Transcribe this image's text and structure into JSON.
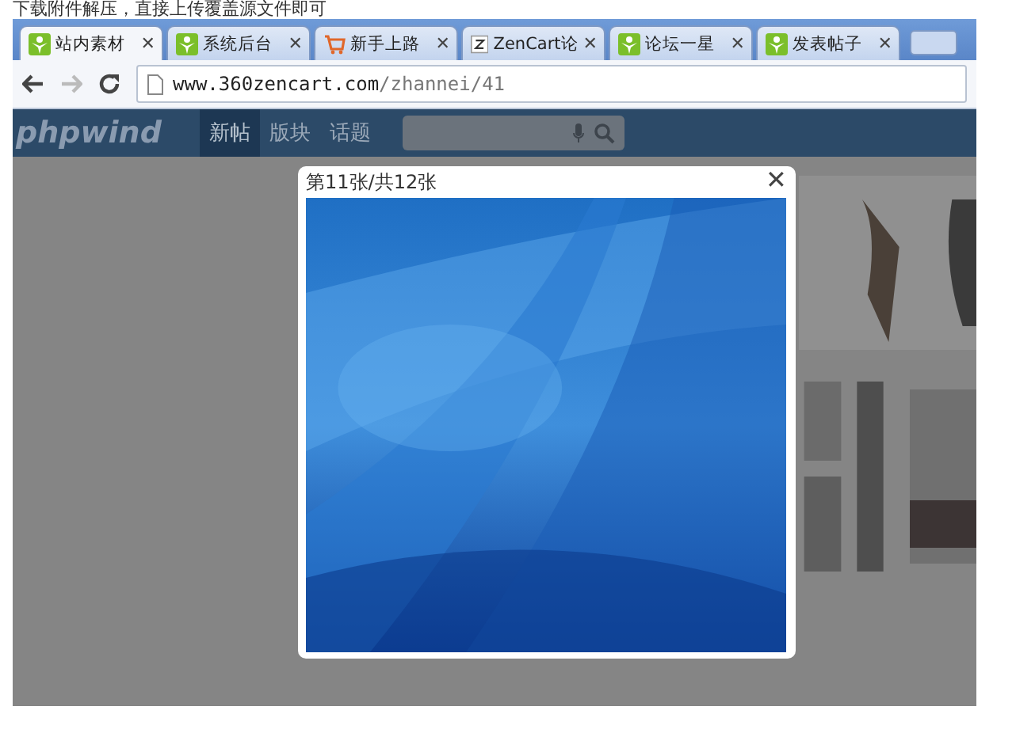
{
  "caption": "下载附件解压，直接上传覆盖源文件即可",
  "tabs": [
    {
      "label": "站内素材",
      "kind": "leaf",
      "close": "✕",
      "selected": true
    },
    {
      "label": "系统后台",
      "kind": "leaf",
      "close": "✕",
      "selected": false
    },
    {
      "label": "新手上路",
      "kind": "cart",
      "close": "✕",
      "selected": false
    },
    {
      "label": "ZenCart论",
      "kind": "z",
      "close": "✕",
      "selected": false
    },
    {
      "label": "论坛一星",
      "kind": "leaf",
      "close": "✕",
      "selected": false
    },
    {
      "label": "发表帖子",
      "kind": "leaf",
      "close": "✕",
      "selected": false
    }
  ],
  "address": {
    "host": "www.360zencart.com",
    "path": "/zhannei/41"
  },
  "nav": {
    "logo": "phpwind",
    "items": [
      {
        "label": "新帖",
        "selected": true
      },
      {
        "label": "版块",
        "selected": false
      },
      {
        "label": "话题",
        "selected": false
      }
    ]
  },
  "lightbox": {
    "counter": "第11张/共12张",
    "close": "✕"
  }
}
